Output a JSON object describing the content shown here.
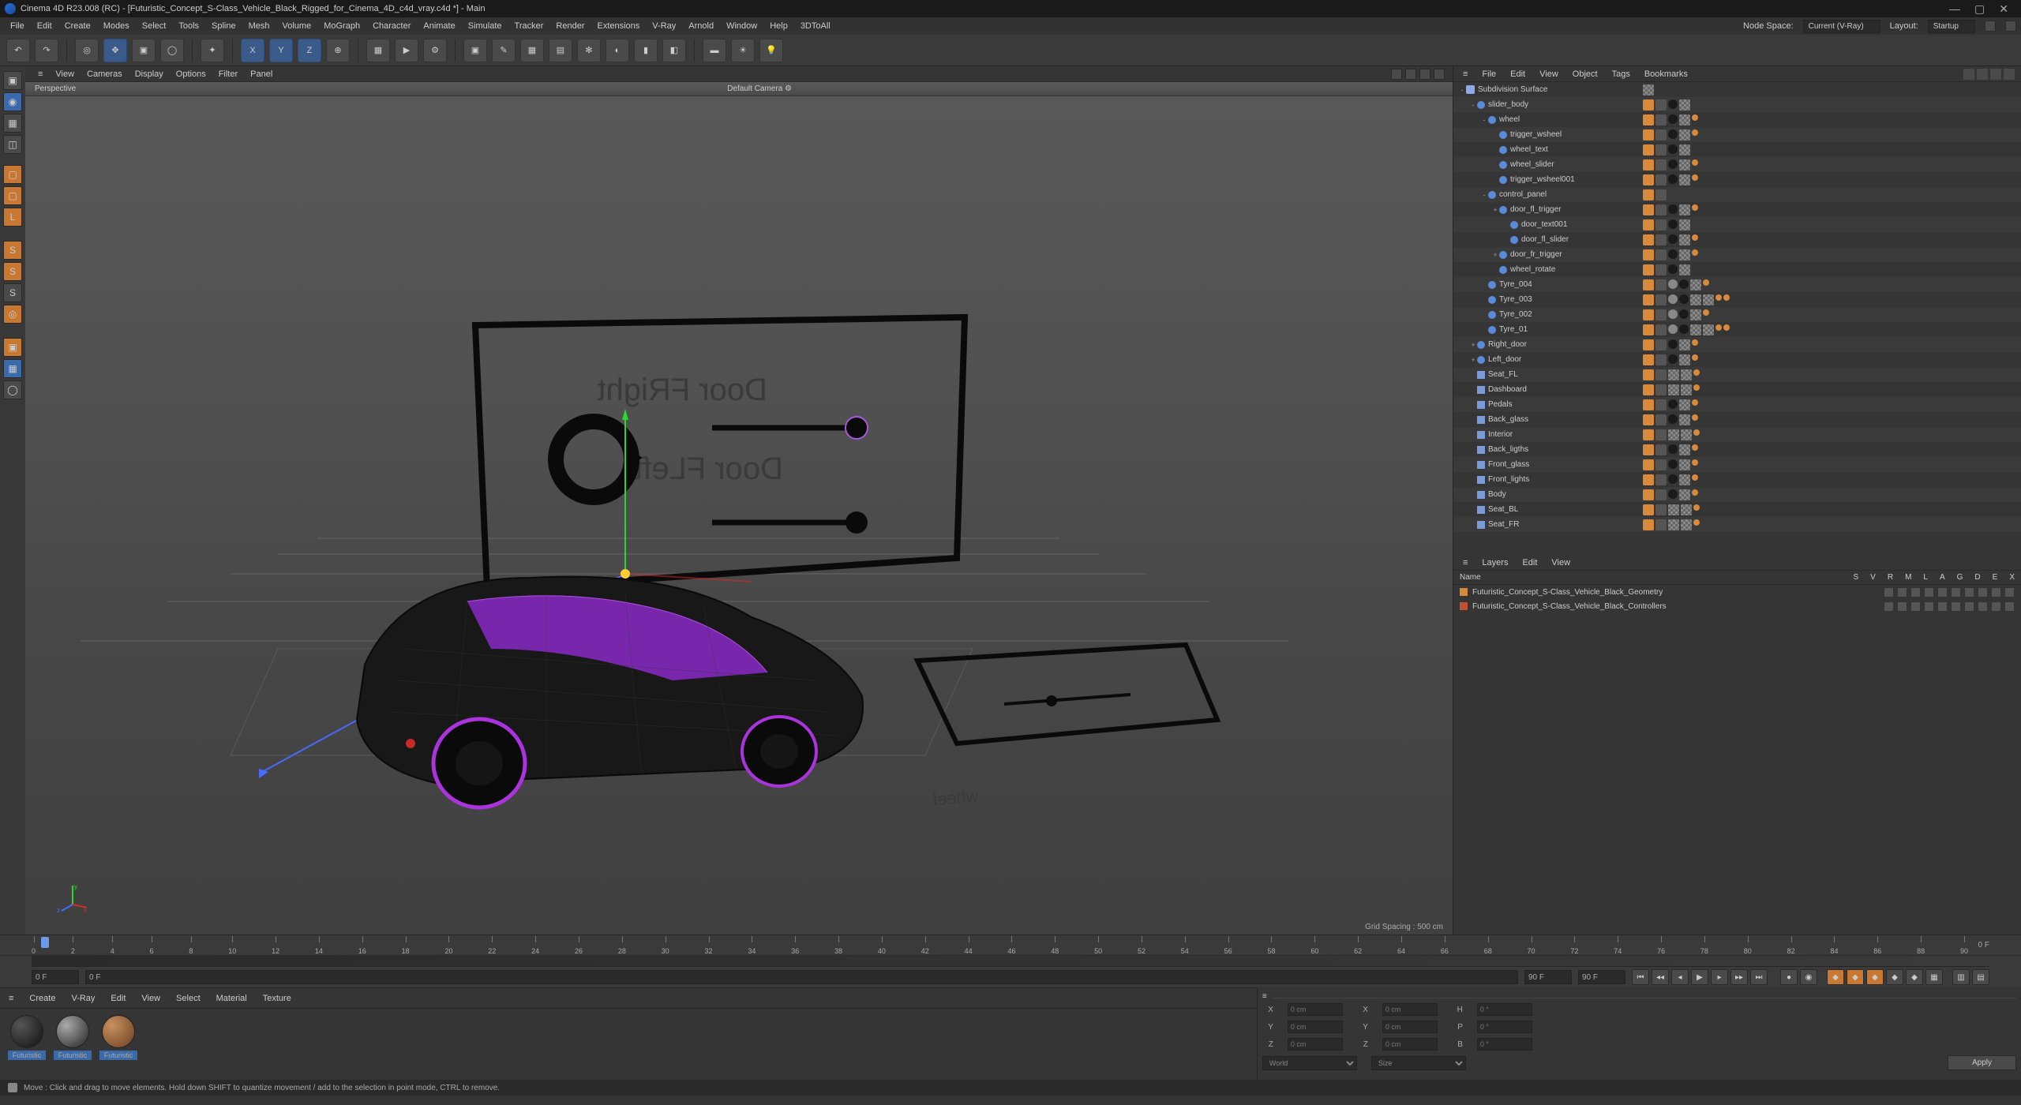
{
  "title": "Cinema 4D R23.008 (RC) - [Futuristic_Concept_S-Class_Vehicle_Black_Rigged_for_Cinema_4D_c4d_vray.c4d *] - Main",
  "menubar": [
    "File",
    "Edit",
    "Create",
    "Modes",
    "Select",
    "Tools",
    "Spline",
    "Mesh",
    "Volume",
    "MoGraph",
    "Character",
    "Animate",
    "Simulate",
    "Tracker",
    "Render",
    "Extensions",
    "V-Ray",
    "Arnold",
    "Window",
    "Help",
    "3DToAll"
  ],
  "nodespace_label": "Node Space:",
  "nodespace_value": "Current (V-Ray)",
  "layout_label": "Layout:",
  "layout_value": "Startup",
  "viewport_menubar": [
    "≡",
    "View",
    "Cameras",
    "Display",
    "Options",
    "Filter",
    "Panel"
  ],
  "viewport_label_left": "Perspective",
  "viewport_label_center": "Default Camera ⚙",
  "grid_spacing": "Grid Spacing : 500 cm",
  "panel_a_view": "Door FRight",
  "panel_b_view": "Door FLeft",
  "panel_small_view": "wheel",
  "objects_menu": [
    "≡",
    "File",
    "Edit",
    "View",
    "Object",
    "Tags",
    "Bookmarks"
  ],
  "objects": [
    {
      "depth": 0,
      "icon": "subd",
      "name": "Subdivision Surface",
      "exp": "-",
      "tags": [
        "checker",
        "dots"
      ]
    },
    {
      "depth": 1,
      "icon": "joint",
      "name": "slider_body",
      "exp": "-",
      "tags": [
        "orange",
        "gray",
        "black-dot",
        "checker"
      ]
    },
    {
      "depth": 2,
      "icon": "joint",
      "name": "wheel",
      "exp": "-",
      "tags": [
        "orange",
        "gray",
        "black-dot",
        "checker",
        "orange-dot"
      ]
    },
    {
      "depth": 3,
      "icon": "joint",
      "name": "trigger_wsheel",
      "exp": "",
      "tags": [
        "orange",
        "gray",
        "black-dot",
        "checker",
        "orange-dot"
      ]
    },
    {
      "depth": 3,
      "icon": "joint",
      "name": "wheel_text",
      "exp": "",
      "tags": [
        "orange",
        "gray",
        "black-dot",
        "checker"
      ]
    },
    {
      "depth": 3,
      "icon": "joint",
      "name": "wheel_slider",
      "exp": "",
      "tags": [
        "orange",
        "gray",
        "black-dot",
        "checker",
        "orange-dot"
      ]
    },
    {
      "depth": 3,
      "icon": "joint",
      "name": "trigger_wsheel001",
      "exp": "",
      "tags": [
        "orange",
        "gray",
        "black-dot",
        "checker",
        "orange-dot"
      ]
    },
    {
      "depth": 2,
      "icon": "joint",
      "name": "control_panel",
      "exp": "-",
      "tags": [
        "orange",
        "gray"
      ]
    },
    {
      "depth": 3,
      "icon": "joint",
      "name": "door_fl_trigger",
      "exp": "+",
      "tags": [
        "orange",
        "gray",
        "black-dot",
        "checker",
        "orange-dot"
      ]
    },
    {
      "depth": 4,
      "icon": "joint",
      "name": "door_text001",
      "exp": "",
      "tags": [
        "orange",
        "gray",
        "black-dot",
        "checker"
      ]
    },
    {
      "depth": 4,
      "icon": "joint",
      "name": "door_fl_slider",
      "exp": "",
      "tags": [
        "orange",
        "gray",
        "black-dot",
        "checker",
        "orange-dot"
      ]
    },
    {
      "depth": 3,
      "icon": "joint",
      "name": "door_fr_trigger",
      "exp": "+",
      "tags": [
        "orange",
        "gray",
        "black-dot",
        "checker",
        "orange-dot"
      ]
    },
    {
      "depth": 3,
      "icon": "joint",
      "name": "wheel_rotate",
      "exp": "",
      "tags": [
        "orange",
        "gray",
        "black-dot",
        "checker"
      ]
    },
    {
      "depth": 2,
      "icon": "joint",
      "name": "Tyre_004",
      "exp": "",
      "tags": [
        "orange",
        "gray",
        "dot",
        "black-dot",
        "checker",
        "orange-dot"
      ]
    },
    {
      "depth": 2,
      "icon": "joint",
      "name": "Tyre_003",
      "exp": "",
      "tags": [
        "orange",
        "gray",
        "dot",
        "black-dot",
        "checker",
        "checker",
        "orange-dot",
        "orange-dot"
      ]
    },
    {
      "depth": 2,
      "icon": "joint",
      "name": "Tyre_002",
      "exp": "",
      "tags": [
        "orange",
        "gray",
        "dot",
        "black-dot",
        "checker",
        "orange-dot"
      ]
    },
    {
      "depth": 2,
      "icon": "joint",
      "name": "Tyre_01",
      "exp": "",
      "tags": [
        "orange",
        "gray",
        "dot",
        "black-dot",
        "checker",
        "checker",
        "orange-dot",
        "orange-dot"
      ]
    },
    {
      "depth": 1,
      "icon": "joint",
      "name": "Right_door",
      "exp": "+",
      "tags": [
        "orange",
        "gray",
        "black-dot",
        "checker",
        "orange-dot"
      ]
    },
    {
      "depth": 1,
      "icon": "joint",
      "name": "Left_door",
      "exp": "+",
      "tags": [
        "orange",
        "gray",
        "black-dot",
        "checker",
        "orange-dot"
      ]
    },
    {
      "depth": 1,
      "icon": "mesh",
      "name": "Seat_FL",
      "exp": "",
      "tags": [
        "orange",
        "gray",
        "checker",
        "checker",
        "orange-dot"
      ]
    },
    {
      "depth": 1,
      "icon": "mesh",
      "name": "Dashboard",
      "exp": "",
      "tags": [
        "orange",
        "gray",
        "checker",
        "checker",
        "orange-dot"
      ]
    },
    {
      "depth": 1,
      "icon": "mesh",
      "name": "Pedals",
      "exp": "",
      "tags": [
        "orange",
        "gray",
        "black-dot",
        "checker",
        "orange-dot"
      ]
    },
    {
      "depth": 1,
      "icon": "mesh",
      "name": "Back_glass",
      "exp": "",
      "tags": [
        "orange",
        "gray",
        "black-dot",
        "checker",
        "orange-dot"
      ]
    },
    {
      "depth": 1,
      "icon": "mesh",
      "name": "Interior",
      "exp": "",
      "tags": [
        "orange",
        "gray",
        "checker",
        "checker",
        "orange-dot"
      ]
    },
    {
      "depth": 1,
      "icon": "mesh",
      "name": "Back_ligths",
      "exp": "",
      "tags": [
        "orange",
        "gray",
        "black-dot",
        "checker",
        "orange-dot"
      ]
    },
    {
      "depth": 1,
      "icon": "mesh",
      "name": "Front_glass",
      "exp": "",
      "tags": [
        "orange",
        "gray",
        "black-dot",
        "checker",
        "orange-dot"
      ]
    },
    {
      "depth": 1,
      "icon": "mesh",
      "name": "Front_lights",
      "exp": "",
      "tags": [
        "orange",
        "gray",
        "black-dot",
        "checker",
        "orange-dot"
      ]
    },
    {
      "depth": 1,
      "icon": "mesh",
      "name": "Body",
      "exp": "",
      "tags": [
        "orange",
        "gray",
        "black-dot",
        "checker",
        "orange-dot"
      ]
    },
    {
      "depth": 1,
      "icon": "mesh",
      "name": "Seat_BL",
      "exp": "",
      "tags": [
        "orange",
        "gray",
        "checker",
        "checker",
        "orange-dot"
      ]
    },
    {
      "depth": 1,
      "icon": "mesh",
      "name": "Seat_FR",
      "exp": "",
      "tags": [
        "orange",
        "gray",
        "checker",
        "checker",
        "orange-dot"
      ]
    }
  ],
  "layers_menu": [
    "≡",
    "Layers",
    "Edit",
    "View"
  ],
  "layer_columns": [
    "S",
    "V",
    "R",
    "M",
    "L",
    "A",
    "G",
    "D",
    "E",
    "X"
  ],
  "layer_name_col": "Name",
  "layers": [
    {
      "cls": "geom",
      "name": "Futuristic_Concept_S-Class_Vehicle_Black_Geometry"
    },
    {
      "cls": "ctrl",
      "name": "Futuristic_Concept_S-Class_Vehicle_Black_Controllers"
    }
  ],
  "timeline": {
    "start_label": "0 F",
    "cur_label": "0 F",
    "end_label": "90 F",
    "end_label2": "90 F",
    "end_frame": "0 F",
    "marks": [
      "0",
      "2",
      "4",
      "6",
      "8",
      "10",
      "12",
      "14",
      "16",
      "18",
      "20",
      "22",
      "24",
      "26",
      "28",
      "30",
      "32",
      "34",
      "36",
      "38",
      "40",
      "42",
      "44",
      "46",
      "48",
      "50",
      "52",
      "54",
      "56",
      "58",
      "60",
      "62",
      "64",
      "66",
      "68",
      "70",
      "72",
      "74",
      "76",
      "78",
      "80",
      "82",
      "84",
      "86",
      "88",
      "90"
    ]
  },
  "bottom_menu": [
    "≡",
    "Create",
    "V-Ray",
    "Edit",
    "View",
    "Select",
    "Material",
    "Texture"
  ],
  "materials": [
    "Futuristic",
    "Futuristic",
    "Futuristic"
  ],
  "attrs": {
    "f1": "X",
    "f1v": "0 cm",
    "f2": "X",
    "f2v": "0 cm",
    "f3": "H",
    "f3v": "0 °",
    "g1": "Y",
    "g1v": "0 cm",
    "g2": "Y",
    "g2v": "0 cm",
    "g3": "P",
    "g3v": "0 °",
    "h1": "Z",
    "h1v": "0 cm",
    "h2": "Z",
    "h2v": "0 cm",
    "h3": "B",
    "h3v": "0 °",
    "dd1": "World",
    "dd2": "Size",
    "apply": "Apply"
  },
  "status": "Move : Click and drag to move elements. Hold down SHIFT to quantize movement / add to the selection in point mode, CTRL to remove."
}
